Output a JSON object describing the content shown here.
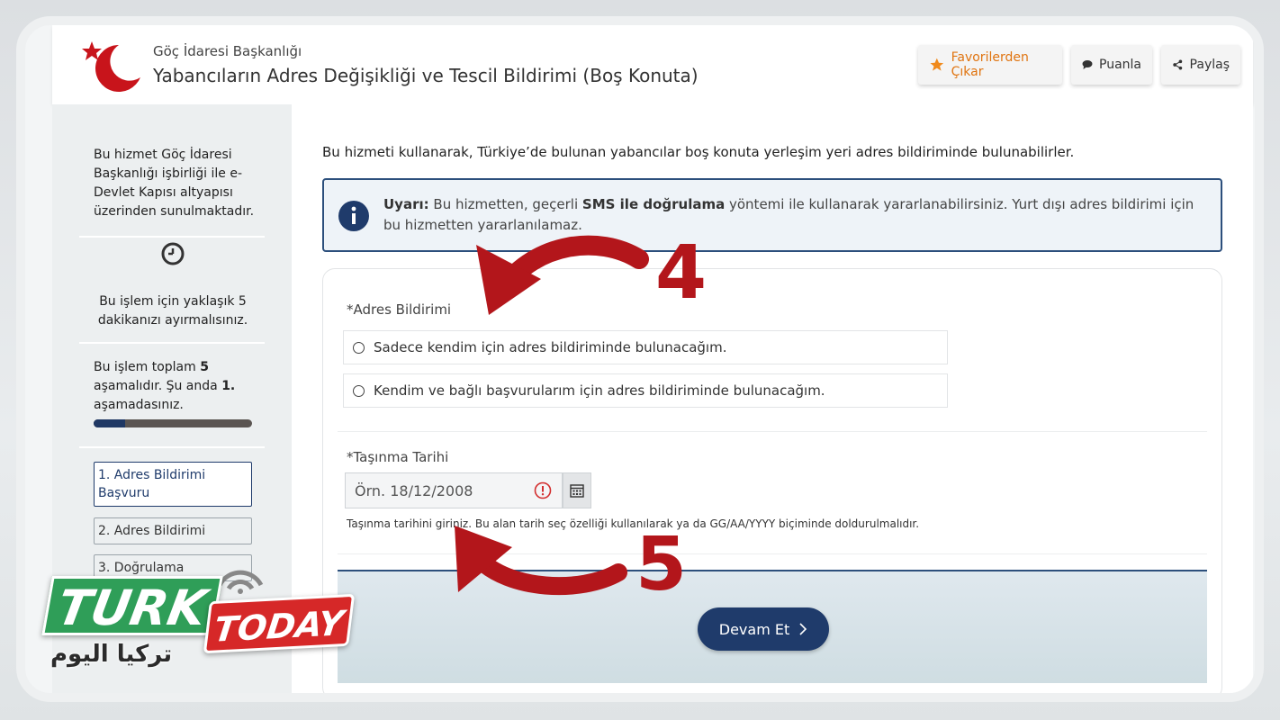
{
  "header": {
    "org_name": "Göç İdaresi Başkanlığı",
    "title": "Yabancıların Adres Değişikliği ve Tescil Bildirimi (Boş Konuta)",
    "buttons": {
      "favorite": "Favorilerden Çıkar",
      "rate": "Puanla",
      "share": "Paylaş"
    }
  },
  "sidebar": {
    "info_line1": "Bu hizmet Göç İdaresi",
    "info_line2": "Başkanlığı işbirliği ile e-",
    "info_line3": "Devlet Kapısı altyapısı",
    "info_line4": "üzerinden sunulmaktadır.",
    "duration_line1": "Bu işlem için yaklaşık 5",
    "duration_line2": "dakikanızı ayırmalısınız.",
    "progress_prefix": "Bu işlem toplam",
    "progress_total": "5",
    "progress_mid": "aşamalıdır. Şu anda",
    "progress_current": "1.",
    "progress_suffix": "aşamadasınız.",
    "progress_fraction": 0.2,
    "steps": [
      {
        "label": "1. Adres Bildirimi Başvuru"
      },
      {
        "label": "2. Adres Bildirimi"
      },
      {
        "label": "3. Doğrulama"
      }
    ]
  },
  "main": {
    "intro": "Bu hizmeti kullanarak, Türkiye’de bulunan yabancılar boş konuta yerleşim yeri adres bildiriminde bulunabilirler.",
    "alert": {
      "prefix": "Uyarı:",
      "text1": "Bu hizmetten, geçerli",
      "bold": "SMS ile doğrulama",
      "text2": "yöntemi ile kullanarak yararlanabilirsiniz. Yurt dışı adres bildirimi için bu hizmetten yararlanılamaz."
    },
    "address_field": {
      "label": "*Adres Bildirimi",
      "options": [
        "Sadece kendim için adres bildiriminde bulunacağım.",
        "Kendim ve bağlı başvurularım için adres bildiriminde bulunacağım."
      ]
    },
    "date_field": {
      "label": "*Taşınma Tarihi",
      "placeholder": "Örn. 18/12/2008",
      "hint": "Taşınma tarihini giriniz. Bu alan tarih seç özelliği kullanılarak ya da GG/AA/YYYY biçiminde doldurulmalıdır."
    },
    "next_button": "Devam Et"
  },
  "annotations": [
    "4",
    "5"
  ],
  "brand": {
    "turk": "TURK",
    "today": "TODAY",
    "arabic": "تركيا اليوم"
  },
  "colors": {
    "primary": "#1f3b6b",
    "accent_orange": "#e07410",
    "annotation_red": "#b3161b"
  }
}
